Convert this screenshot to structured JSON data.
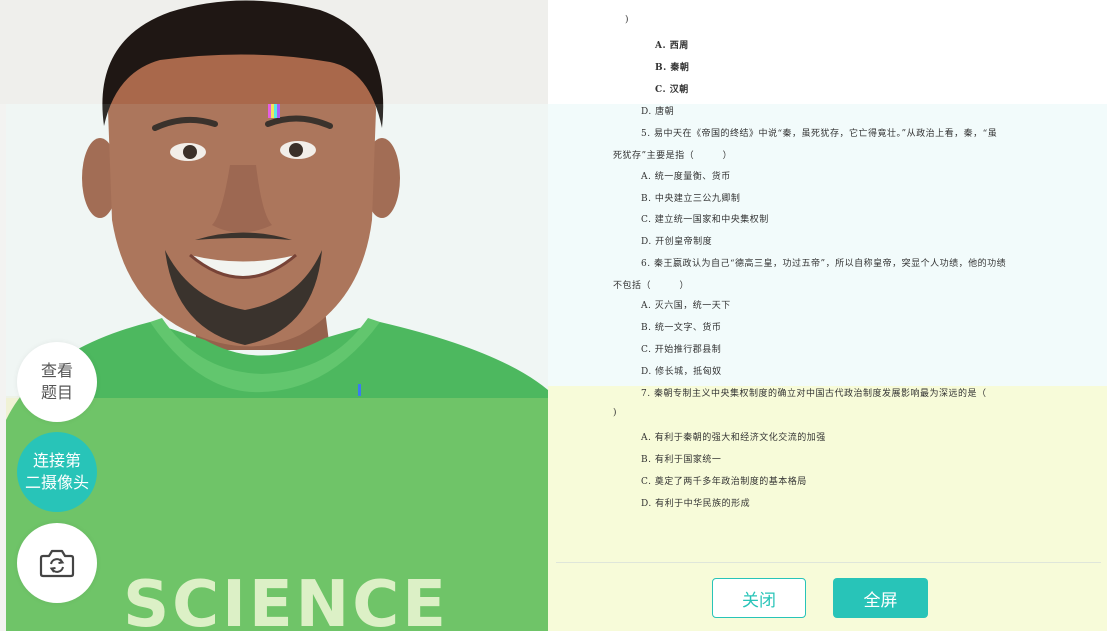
{
  "buttons": {
    "view_question": "查看\n题目",
    "second_camera": "连接第\n二摄像头",
    "camera_icon": "camera-switch-icon",
    "close": "关闭",
    "fullscreen": "全屏"
  },
  "camera": {
    "shirt_text": "SCIENCE"
  },
  "colors": {
    "accent": "#28c4b8",
    "shirt": "#3fb24f",
    "skin": "#a9684b",
    "hair": "#1f1714"
  },
  "question_lines": [
    {
      "text": ")"
    },
    {
      "text": "A. 西周"
    },
    {
      "text": "B. 秦朝"
    },
    {
      "text": "C. 汉朝"
    },
    {
      "text": "D. 唐朝"
    },
    {
      "text": "5. 易中天在《帝国的终结》中说“秦，虽死犹存，它亡得竟壮。”从政治上看，秦，“虽"
    },
    {
      "text": "死犹存”主要是指（　　　）"
    },
    {
      "text": "A. 统一度量衡、货币"
    },
    {
      "text": "B. 中央建立三公九卿制"
    },
    {
      "text": "C. 建立统一国家和中央集权制"
    },
    {
      "text": "D. 开创皇帝制度"
    },
    {
      "text": "6. 秦王嬴政认为自己“德高三皇，功过五帝”，所以自称皇帝，突显个人功绩，他的功绩"
    },
    {
      "text": "不包括（　　　）"
    },
    {
      "text": "A. 灭六国，统一天下"
    },
    {
      "text": "B. 统一文字、货币"
    },
    {
      "text": "C. 开始推行郡县制"
    },
    {
      "text": "D. 修长城，抵匈奴"
    },
    {
      "text": "7. 秦朝专制主义中央集权制度的确立对中国古代政治制度发展影响最为深远的是（"
    },
    {
      "text": ")"
    },
    {
      "text": "A. 有利于秦朝的强大和经济文化交流的加强"
    },
    {
      "text": "B. 有利于国家统一"
    },
    {
      "text": "C. 奠定了两千多年政治制度的基本格局"
    },
    {
      "text": "D. 有利于中华民族的形成"
    }
  ]
}
